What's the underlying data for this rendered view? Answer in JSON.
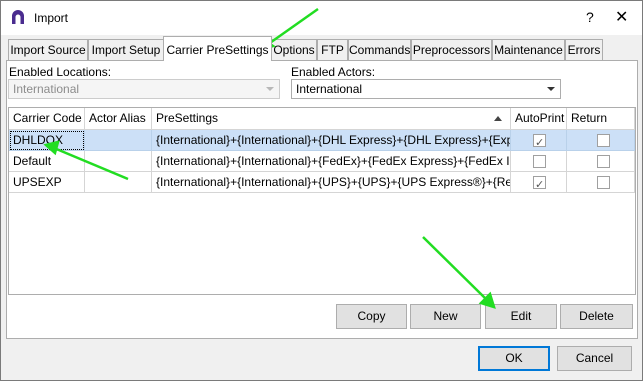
{
  "window": {
    "title": "Import",
    "help_glyph": "?",
    "close_glyph": "✕"
  },
  "tabs": [
    {
      "label": "Import Source"
    },
    {
      "label": "Import Setup"
    },
    {
      "label": "Carrier PreSettings",
      "active": true
    },
    {
      "label": "Options"
    },
    {
      "label": "FTP"
    },
    {
      "label": "Commands"
    },
    {
      "label": "Preprocessors"
    },
    {
      "label": "Maintenance"
    },
    {
      "label": "Errors"
    }
  ],
  "enabled_locations": {
    "label": "Enabled Locations:",
    "value": "International"
  },
  "enabled_actors": {
    "label": "Enabled Actors:",
    "value": "International"
  },
  "table": {
    "columns": [
      "Carrier Code",
      "Actor Alias",
      "PreSettings",
      "AutoPrint",
      "Return"
    ],
    "rows": [
      {
        "carrier_code": "DHLDOX",
        "actor_alias": "",
        "presettings": "{International}+{International}+{DHL Express}+{DHL Express}+{Exp...",
        "autoprint": true,
        "return": false
      },
      {
        "carrier_code": "Default",
        "actor_alias": "",
        "presettings": "{International}+{International}+{FedEx}+{FedEx Express}+{FedEx I...",
        "autoprint": false,
        "return": false
      },
      {
        "carrier_code": "UPSEXP",
        "actor_alias": "",
        "presettings": "{International}+{International}+{UPS}+{UPS}+{UPS Express®}+{Re...",
        "autoprint": true,
        "return": false
      }
    ]
  },
  "buttons": {
    "copy": "Copy",
    "new": "New",
    "edit": "Edit",
    "delete": "Delete",
    "ok": "OK",
    "cancel": "Cancel"
  },
  "colors": {
    "selection": "#cce0f7",
    "accent": "#0078d7",
    "annotation_arrow": "#22dd22",
    "app_icon": "#4a2c8f"
  }
}
